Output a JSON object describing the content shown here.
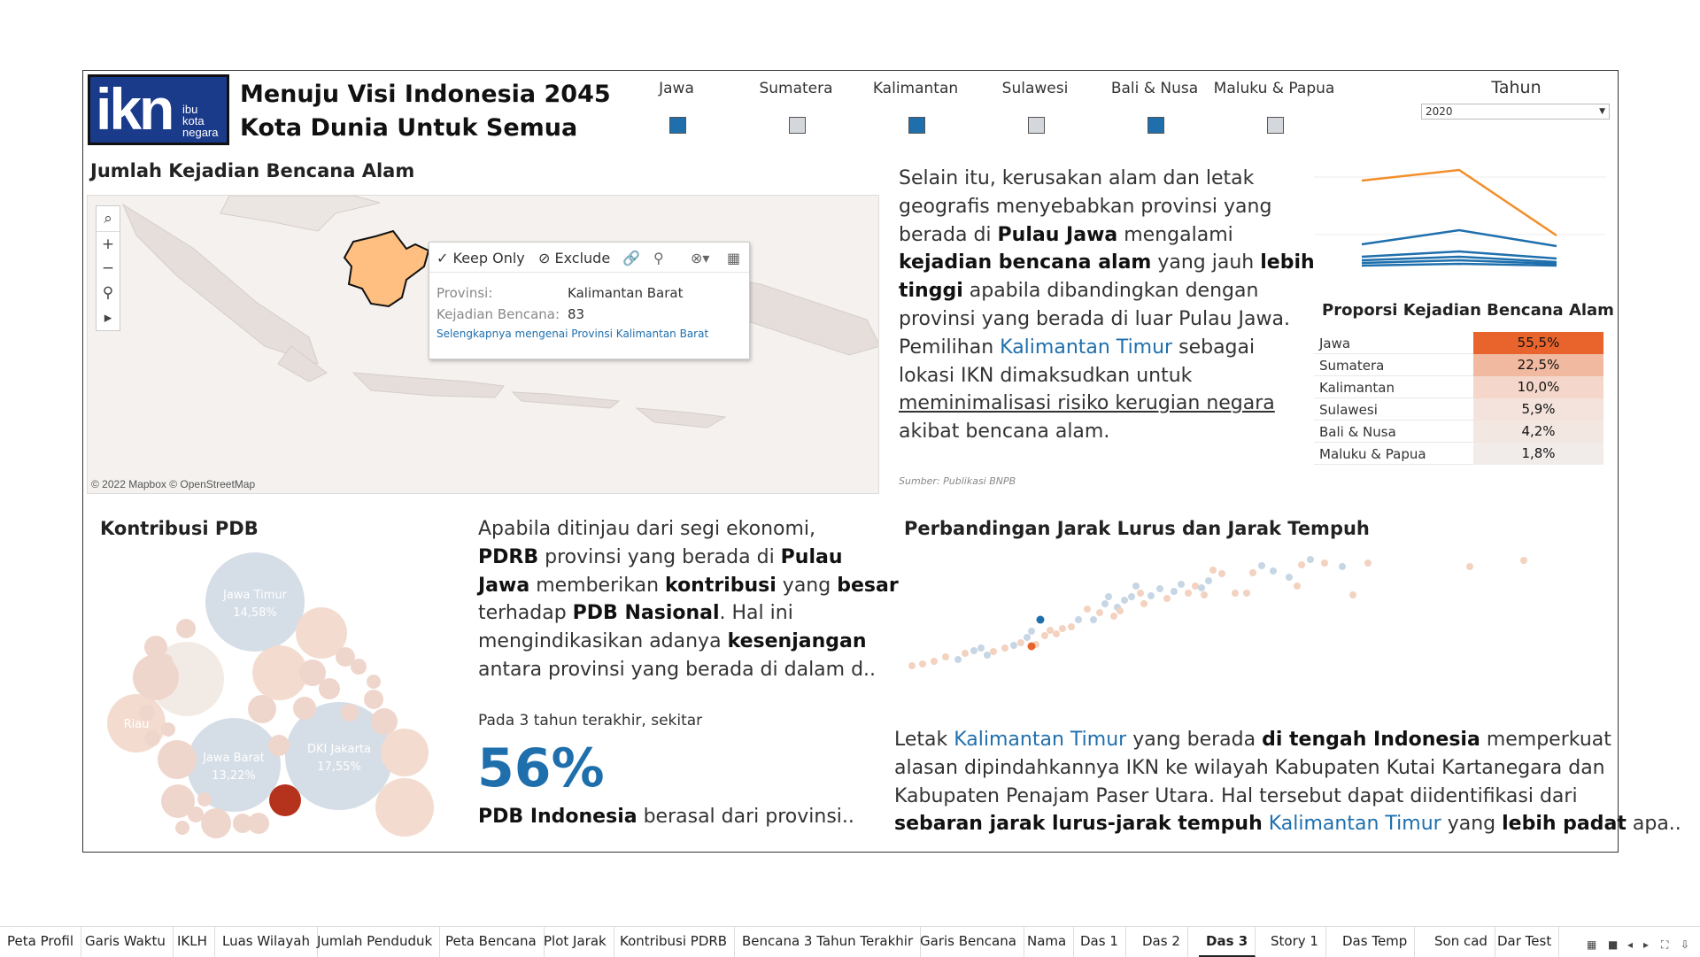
{
  "header": {
    "logo_big": "ikn",
    "logo_small": [
      "ibu",
      "kota",
      "negara"
    ],
    "title_line1": "Menuju Visi Indonesia 2045",
    "title_line2": "Kota Dunia Untuk Semua"
  },
  "regions": [
    {
      "label": "Jawa",
      "checked": true
    },
    {
      "label": "Sumatera",
      "checked": false
    },
    {
      "label": "Kalimantan",
      "checked": true
    },
    {
      "label": "Sulawesi",
      "checked": false
    },
    {
      "label": "Bali & Nusa",
      "checked": true
    },
    {
      "label": "Maluku & Papua",
      "checked": false
    }
  ],
  "year_filter": {
    "label": "Tahun",
    "value": "2020"
  },
  "map_section": {
    "title": "Jumlah Kejadian Bencana Alam",
    "credit": "© 2022 Mapbox © OpenStreetMap",
    "tooltip": {
      "keep_only": "Keep Only",
      "exclude": "Exclude",
      "provinsi_label": "Provinsi:",
      "provinsi_value": "Kalimantan Barat",
      "kejadian_label": "Kejadian Bencana:",
      "kejadian_value": "83",
      "link": "Selengkapnya mengenai Provinsi Kalimantan Barat"
    }
  },
  "bencana_text": {
    "l1": "Selain itu, kerusakan alam dan letak",
    "l2": "geografis menyebabkan provinsi yang",
    "l3a": "berada di ",
    "l3b": "Pulau Jawa",
    "l3c": " mengalami",
    "l4a": "kejadian bencana alam",
    "l4b": "  yang jauh ",
    "l4c": "lebih",
    "l5a": "tinggi",
    "l5b": " apabila dibandingkan dengan",
    "l6": "provinsi yang berada di luar Pulau Jawa.",
    "l7a": "Pemilihan ",
    "l7b": "Kalimantan Timur",
    "l7c": " sebagai",
    "l8": "lokasi IKN dimaksudkan untuk",
    "l9": "meminimalisasi risiko kerugian negara",
    "l10": "akibat bencana alam.",
    "source": "Sumber: Publikasi BNPB"
  },
  "proporsi": {
    "title": "Proporsi Kejadian Bencana Alam",
    "rows": [
      {
        "name": "Jawa",
        "value": "55,5%",
        "color": "#e8642c"
      },
      {
        "name": "Sumatera",
        "value": "22,5%",
        "color": "#f0b9a0"
      },
      {
        "name": "Kalimantan",
        "value": "10,0%",
        "color": "#f4d7ca"
      },
      {
        "name": "Sulawesi",
        "value": "5,9%",
        "color": "#f3e3dc"
      },
      {
        "name": "Bali & Nusa",
        "value": "4,2%",
        "color": "#f3e7e2"
      },
      {
        "name": "Maluku & Papua",
        "value": "1,8%",
        "color": "#f1ecea"
      }
    ]
  },
  "pdb": {
    "title": "Kontribusi PDB",
    "bubbles": [
      {
        "label": "Jawa Timur",
        "value": "14,58%"
      },
      {
        "label": "Riau",
        "value": ""
      },
      {
        "label": "Jawa Barat",
        "value": "13,22%"
      },
      {
        "label": "DKI Jakarta",
        "value": "17,55%"
      }
    ],
    "text": {
      "l1": "Apabila ditinjau dari segi ekonomi,",
      "l2a": "PDRB",
      "l2b": " provinsi yang berada di ",
      "l2c": "Pulau",
      "l3a": "Jawa",
      "l3b": " memberikan ",
      "l3c": "kontribusi",
      "l3d": " yang ",
      "l3e": "besar",
      "l4a": "terhadap ",
      "l4b": "PDB Nasional",
      "l4c": ". Hal ini",
      "l5a": "mengindikasikan adanya ",
      "l5b": "kesenjangan",
      "l6": "antara provinsi yang berada di dalam d.."
    },
    "pre_stat": "Pada 3 tahun terakhir, sekitar",
    "stat": "56%",
    "post_a": "PDB Indonesia",
    "post_b": " berasal dari provinsi.."
  },
  "jarak": {
    "title": "Perbandingan Jarak Lurus dan Jarak Tempuh",
    "text": {
      "l1a": "Letak ",
      "l1b": "Kalimantan Timur",
      "l1c": " yang berada ",
      "l1d": "di tengah Indonesia",
      "l1e": " memperkuat",
      "l2": "alasan dipindahkannya IKN ke wilayah Kabupaten Kutai Kartanegara dan",
      "l3": "Kabupaten Penajam Paser Utara. Hal tersebut dapat diidentifikasi dari",
      "l4a": "sebaran jarak lurus-jarak tempuh",
      "l4b": " ",
      "l4c": "Kalimantan Timur",
      "l4d": " yang ",
      "l4e": "lebih padat",
      "l4f": " apa.."
    }
  },
  "tabs": [
    "Peta Profil",
    "Garis Waktu",
    "IKLH",
    "Luas Wilayah",
    "Jumlah Penduduk",
    "Peta Bencana",
    "Plot Jarak",
    "Kontribusi PDRB",
    "Bencana 3 Tahun Terakhir",
    "Garis Bencana",
    "Nama",
    "Das 1",
    "Das 2",
    "Das 3",
    "Story 1",
    "Das Temp",
    "Son cad",
    "Dar Test"
  ],
  "active_tab": "Das 3"
}
